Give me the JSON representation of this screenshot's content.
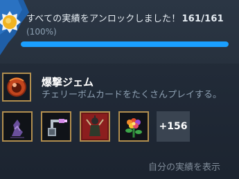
{
  "progress": {
    "title": "すべての実績をアンロックしました！",
    "count": "161/161",
    "percent_label": "(100%)",
    "fill_fraction": 1.0,
    "fill_color": "#1a9fff"
  },
  "featured": {
    "icon": "bomb-gem-icon",
    "name": "爆撃ジェム",
    "description": "チェリーボムカードをたくさんプレイする。"
  },
  "thumbnails": [
    {
      "icon": "purple-creature-icon"
    },
    {
      "icon": "robot-arm-icon"
    },
    {
      "icon": "red-figure-icon"
    },
    {
      "icon": "flower-icon"
    }
  ],
  "more_count": "+156",
  "show_link": "自分の実績を表示",
  "colors": {
    "border_gold": "#b28f4f",
    "badge_blue": "#1f5fa8"
  }
}
